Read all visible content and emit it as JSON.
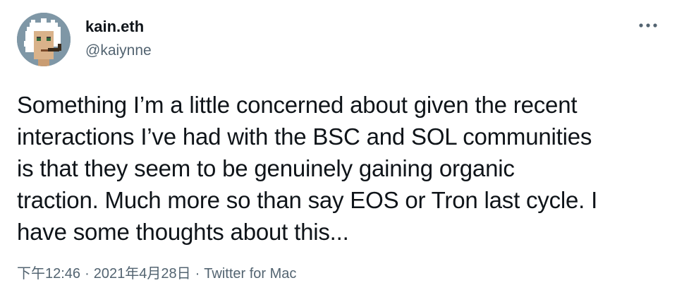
{
  "author": {
    "display_name": "kain.eth",
    "handle": "@kaiynne",
    "avatar_icon": "pixel-art-avatar-icon"
  },
  "menu": {
    "more_icon": "more-horizontal-icon"
  },
  "tweet": {
    "lines": [
      "Something I’m a little concerned about given the recent",
      "interactions I’ve had with the BSC and SOL communities",
      "is that they seem to be genuinely gaining organic",
      "traction. Much more so than say EOS or Tron last cycle. I",
      "have some thoughts about this..."
    ]
  },
  "meta": {
    "time": "下午12:46",
    "date": "2021年4月28日",
    "separator": "·",
    "source": "Twitter for Mac"
  },
  "colors": {
    "text_primary": "#0f1419",
    "text_secondary": "#536471",
    "background": "#ffffff"
  }
}
